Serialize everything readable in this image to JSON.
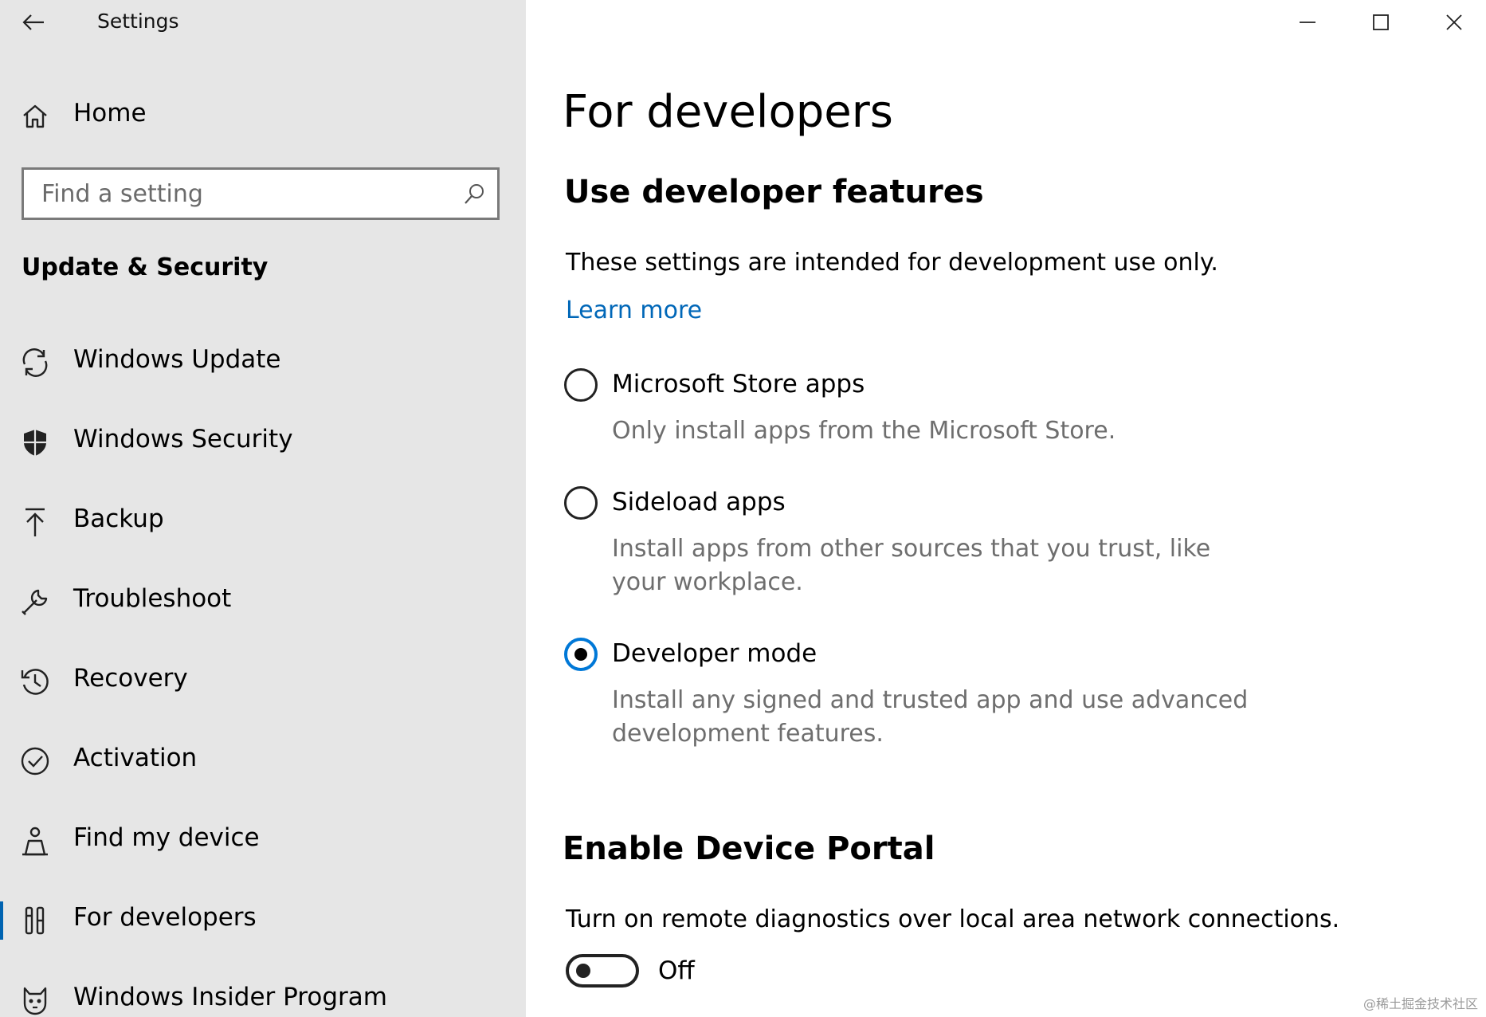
{
  "app": {
    "title": "Settings"
  },
  "sidebar": {
    "home_label": "Home",
    "search_placeholder": "Find a setting",
    "section_title": "Update & Security",
    "items": [
      {
        "label": "Windows Update",
        "icon": "refresh-icon"
      },
      {
        "label": "Windows Security",
        "icon": "shield-icon"
      },
      {
        "label": "Backup",
        "icon": "upload-arrow-icon"
      },
      {
        "label": "Troubleshoot",
        "icon": "wrench-icon"
      },
      {
        "label": "Recovery",
        "icon": "history-icon"
      },
      {
        "label": "Activation",
        "icon": "check-circle-icon"
      },
      {
        "label": "Find my device",
        "icon": "person-location-icon"
      },
      {
        "label": "For developers",
        "icon": "developer-tools-icon",
        "selected": true
      },
      {
        "label": "Windows Insider Program",
        "icon": "insider-cat-icon"
      }
    ]
  },
  "main": {
    "page_title": "For developers",
    "section_title": "Use developer features",
    "description": "These settings are intended for development use only.",
    "learn_more": "Learn more",
    "options": [
      {
        "label": "Microsoft Store apps",
        "description": "Only install apps from the Microsoft Store.",
        "checked": false
      },
      {
        "label": "Sideload apps",
        "description": "Install apps from other sources that you trust, like your workplace.",
        "checked": false
      },
      {
        "label": "Developer mode",
        "description": "Install any signed and trusted app and use advanced development features.",
        "checked": true
      }
    ],
    "portal": {
      "title": "Enable Device Portal",
      "description": "Turn on remote diagnostics over local area network connections.",
      "toggle_state": "Off"
    }
  },
  "watermark": "@稀土掘金技术社区",
  "colors": {
    "sidebar_bg": "#e6e6e6",
    "accent": "#0078d7",
    "link": "#0067b8"
  }
}
